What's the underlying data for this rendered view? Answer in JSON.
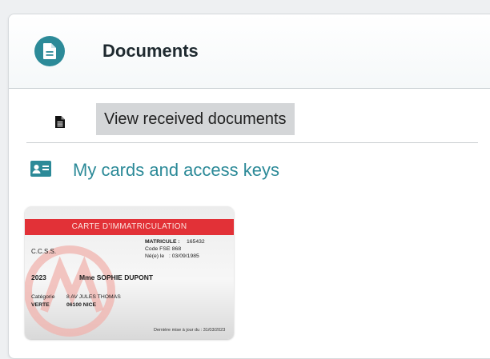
{
  "panel": {
    "title": "Documents",
    "header_icon": "document-icon"
  },
  "received": {
    "icon": "file-icon",
    "label": "View received documents"
  },
  "cards_section": {
    "icon": "id-card-icon",
    "title": "My cards and access keys"
  },
  "card": {
    "band_title": "CARTE D'IMMATRICULATION",
    "issuer": "C.C.S.S.",
    "matricule_label": "MATRICULE :",
    "matricule_value": "165432",
    "code_fse_label": "Code FSE",
    "code_fse_value": ": 868",
    "born_label": "Né(e) le",
    "born_value": ": 03/09/1985",
    "year": "2023",
    "holder": "Mme SOPHIE DUPONT",
    "category_label": "Catégorie",
    "category_value": "VERTE",
    "address_line1": "8 AV JULES THOMAS",
    "address_line2": "06100 NICE",
    "last_update": "Dernière mise à jour du : 31/03/2023",
    "band_color": "#e23137",
    "logo_color": "#f0b3ae"
  },
  "colors": {
    "accent": "#2c8a98",
    "highlight_bg": "#d4d6d8"
  }
}
